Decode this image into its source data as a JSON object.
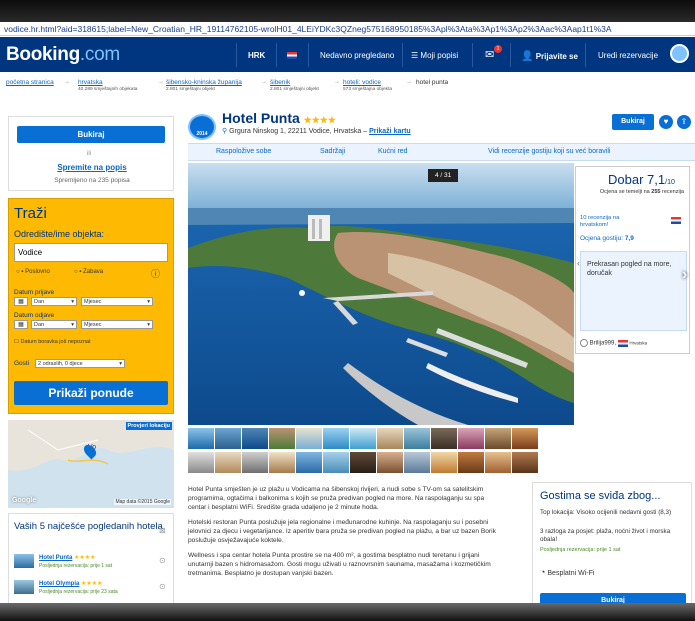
{
  "url": "vodice.hr.html?aid=318615;label=New_Croatian_HR_19114762105-wrolH01_4LEiYDKc3QZneg575168950185%3Apl%3Ata%3Ap1%3Ap2%3Aac%3Aap1t1%3A",
  "brand": {
    "name": "Booking",
    "tld": ".com"
  },
  "nav": {
    "currency": "HRK",
    "recent": "Nedavno pregledano",
    "lists": "Moji popisi",
    "messages_count": "1",
    "signin": "Prijavite se",
    "manage": "Uredi rezervacije"
  },
  "breadcrumbs": [
    {
      "label": "početna stranica",
      "sub": ""
    },
    {
      "label": "hrvatska",
      "sub": "40.289 smještajnih objekata"
    },
    {
      "label": "šibensko-kninska županija",
      "sub": "2.801 smještajni objekt"
    },
    {
      "label": "šibenik",
      "sub": "2.801 smještajni objekt"
    },
    {
      "label": "hoteli: vodice",
      "sub": "573 smještajna objekta"
    },
    {
      "label": "hotel punta",
      "sub": ""
    }
  ],
  "left": {
    "book_btn": "Bukiraj",
    "save_link": "Spremite na popis",
    "saved_count": "Spremljeno na 235 popisa",
    "search_title": "Traži",
    "dest_label": "Odredište/ime objekta:",
    "dest_value": "Vodice",
    "purpose_business": "Poslovno",
    "purpose_leisure": "Zabava",
    "checkin_label": "Datum prijave",
    "checkout_label": "Datum odjave",
    "day_placeholder": "Dan",
    "month_placeholder": "Mjesec",
    "no_dates": "Datum boravka još nepoznat",
    "guests_label": "Gosti",
    "guests_value": "2 odraslih, 0 djece",
    "show_btn": "Prikaži ponude",
    "map_btn": "Provjeri lokaciju",
    "map_credit": "Map data ©2015 Google",
    "map_google": "Google",
    "map_place": "Vo",
    "recent_title": "Vaših 5 najčešće pogledanih hotela",
    "recent_items": [
      {
        "name": "Hotel Punta",
        "stars": "★★★★",
        "note": "Posljednja rezervacija: prije 1 sat"
      },
      {
        "name": "Hotel Olympia",
        "stars": "★★★★",
        "note": "Posljednja rezervacija: prije 23 sata"
      }
    ]
  },
  "hotel": {
    "name": "Hotel Punta",
    "stars": "★★★★",
    "badge_year": "2014",
    "address": "Grgura Ninskog 1, 22211 Vodice, Hrvatska –",
    "map_link": "Prikaži kartu",
    "book_btn": "Bukiraj"
  },
  "tabs": [
    "Raspoložive sobe",
    "Sadržaji",
    "Kućni red",
    "Vidi recenzije gostiju koji su već boravili"
  ],
  "photo": {
    "counter": "4 / 31"
  },
  "rating": {
    "label": "Dobar",
    "score": "7,1",
    "out_of": "/10",
    "based_on": "Ocjena se temelji na",
    "review_count": "255",
    "reviews_word": "recenzija",
    "local_reviews": "10 recenzija na hrvatskom!",
    "guest_score_label": "Ocjena gostiju:",
    "guest_score": "7,9",
    "quote": "Prekrasan pogled na more, doručak",
    "reviewer": "Brilija999,",
    "reviewer_country": "Hrvatska"
  },
  "description": [
    "Hotel Punta smješten je uz plažu u Vodicama na šibenskoj rivijeri, a nudi sobe s TV-om sa satelitskim programima, ogtačima i balkonima s kojih se pruža predivan pogled na more. Na raspolaganju su spa centar i besplatni WiFi. Središte grada udaljeno je 2 minute hoda.",
    "Hotelski restoran Punta poslužuje jela regionalne i međunarodne kuhinje. Na raspolaganju su i posebni jelovnici za djecu i vegetarijance. Iz aperitiv bara pruža se predivan pogled na plažu, a bar uz bazen Borik poslužuje osvježavajuće koktele.",
    "Wellness i spa centar hotela Punta prostire se na 400 m², a gostima besplatno nudi teretanu i grijani unutarnji bazen s hidromasažom. Gosti mogu uživati u raznovrsnim saunama, masažama i kozmetičkim tretmanima. Besplatno je dostupan vanjski bazen."
  ],
  "guests_box": {
    "title": "Gostima se sviđa zbog...",
    "top_location": "Top lokacija: Visoko ocijenili nedavni gosti (8,3)",
    "reasons": "3 razloga za posjet: plaža, noćni život i morska obala!",
    "last_booking": "Posljednja rezervacija: prije 1 sat",
    "wifi": "Besplatni Wi-Fi",
    "btn": "Bukiraj"
  },
  "colors": {
    "brand": "#003580",
    "accent": "#0a6fd4",
    "search": "#feba02"
  }
}
